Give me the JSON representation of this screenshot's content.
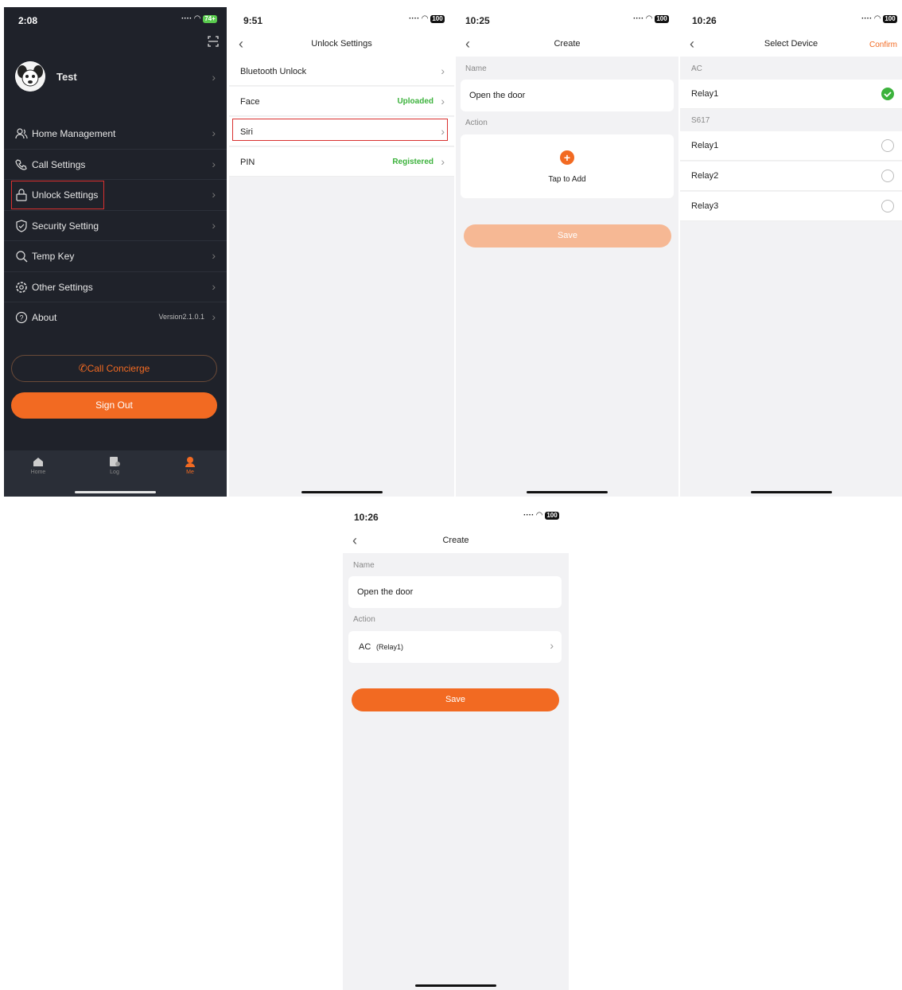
{
  "accent_color": "#f26a22",
  "p1": {
    "time": "2:08",
    "battery": "74+",
    "user_name": "Test",
    "menu": [
      {
        "icon": "home-users-icon",
        "label": "Home Management",
        "value": ""
      },
      {
        "icon": "phone-settings-icon",
        "label": "Call Settings",
        "value": ""
      },
      {
        "icon": "lock-icon",
        "label": "Unlock Settings",
        "value": ""
      },
      {
        "icon": "shield-icon",
        "label": "Security Setting",
        "value": ""
      },
      {
        "icon": "key-search-icon",
        "label": "Temp Key",
        "value": ""
      },
      {
        "icon": "gear-icon",
        "label": "Other Settings",
        "value": ""
      },
      {
        "icon": "question-icon",
        "label": "About",
        "value": "Version2.1.0.1"
      }
    ],
    "concierge": "Call Concierge",
    "signout": "Sign Out",
    "tabs": [
      "Home",
      "Log",
      "Me"
    ]
  },
  "p2": {
    "time": "9:51",
    "battery": "100",
    "title": "Unlock Settings",
    "rows": [
      {
        "label": "Bluetooth Unlock",
        "value": ""
      },
      {
        "label": "Face",
        "value": "Uploaded"
      },
      {
        "label": "Siri",
        "value": ""
      },
      {
        "label": "PIN",
        "value": "Registered"
      }
    ]
  },
  "p3": {
    "time": "10:25",
    "battery": "100",
    "title": "Create",
    "name_label": "Name",
    "name_value": "Open the door",
    "action_label": "Action",
    "tap_to_add": "Tap to Add",
    "save": "Save"
  },
  "p4": {
    "time": "10:26",
    "battery": "100",
    "title": "Select Device",
    "confirm": "Confirm",
    "group1": "AC",
    "group1_items": [
      "Relay1"
    ],
    "group2": "S617",
    "group2_items": [
      "Relay1",
      "Relay2",
      "Relay3"
    ]
  },
  "p5": {
    "time": "10:26",
    "battery": "100",
    "title": "Create",
    "name_label": "Name",
    "name_value": "Open the door",
    "action_label": "Action",
    "action_device": "AC",
    "action_relay": "(Relay1)",
    "save": "Save"
  }
}
